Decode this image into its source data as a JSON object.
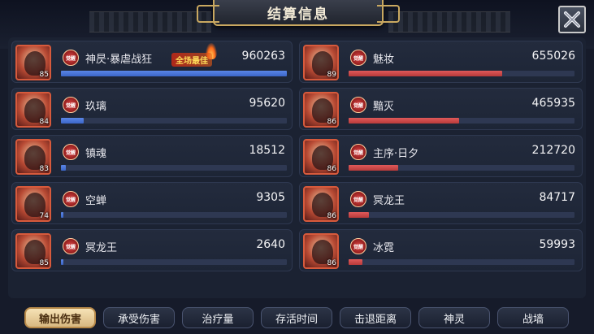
{
  "header": {
    "title": "结算信息"
  },
  "colors": {
    "ally_bar": "#4a76d8",
    "enemy_bar": "#d04848",
    "active_tab": "#e8cc98"
  },
  "left_rows": [
    {
      "name": "神昃·暴虐战狂",
      "value": "960263",
      "level": "85",
      "badge": "觉醒",
      "mvp": "全场最佳",
      "fill": 1.0
    },
    {
      "name": "玖璃",
      "value": "95620",
      "level": "84",
      "badge": "觉醒",
      "fill": 0.1
    },
    {
      "name": "镇魂",
      "value": "18512",
      "level": "83",
      "badge": "觉醒",
      "fill": 0.02
    },
    {
      "name": "空蝉",
      "value": "9305",
      "level": "74",
      "badge": "觉醒",
      "fill": 0.01
    },
    {
      "name": "冥龙王",
      "value": "2640",
      "level": "85",
      "badge": "觉醒",
      "fill": 0.003
    }
  ],
  "right_rows": [
    {
      "name": "魅妆",
      "value": "655026",
      "level": "89",
      "badge": "觉醒",
      "fill": 0.68
    },
    {
      "name": "黯灭",
      "value": "465935",
      "level": "86",
      "badge": "觉醒",
      "fill": 0.49
    },
    {
      "name": "主序·日夕",
      "value": "212720",
      "level": "86",
      "badge": "觉醒",
      "fill": 0.22
    },
    {
      "name": "冥龙王",
      "value": "84717",
      "level": "86",
      "badge": "觉醒",
      "fill": 0.09
    },
    {
      "name": "冰霓",
      "value": "59993",
      "level": "86",
      "badge": "觉醒",
      "fill": 0.06
    }
  ],
  "tabs": [
    "输出伤害",
    "承受伤害",
    "治疗量",
    "存活时间",
    "击退距离",
    "神灵",
    "战墙"
  ],
  "active_tab": "输出伤害",
  "icons": {
    "close": "close-x-icon",
    "mvp": "flame-icon"
  }
}
